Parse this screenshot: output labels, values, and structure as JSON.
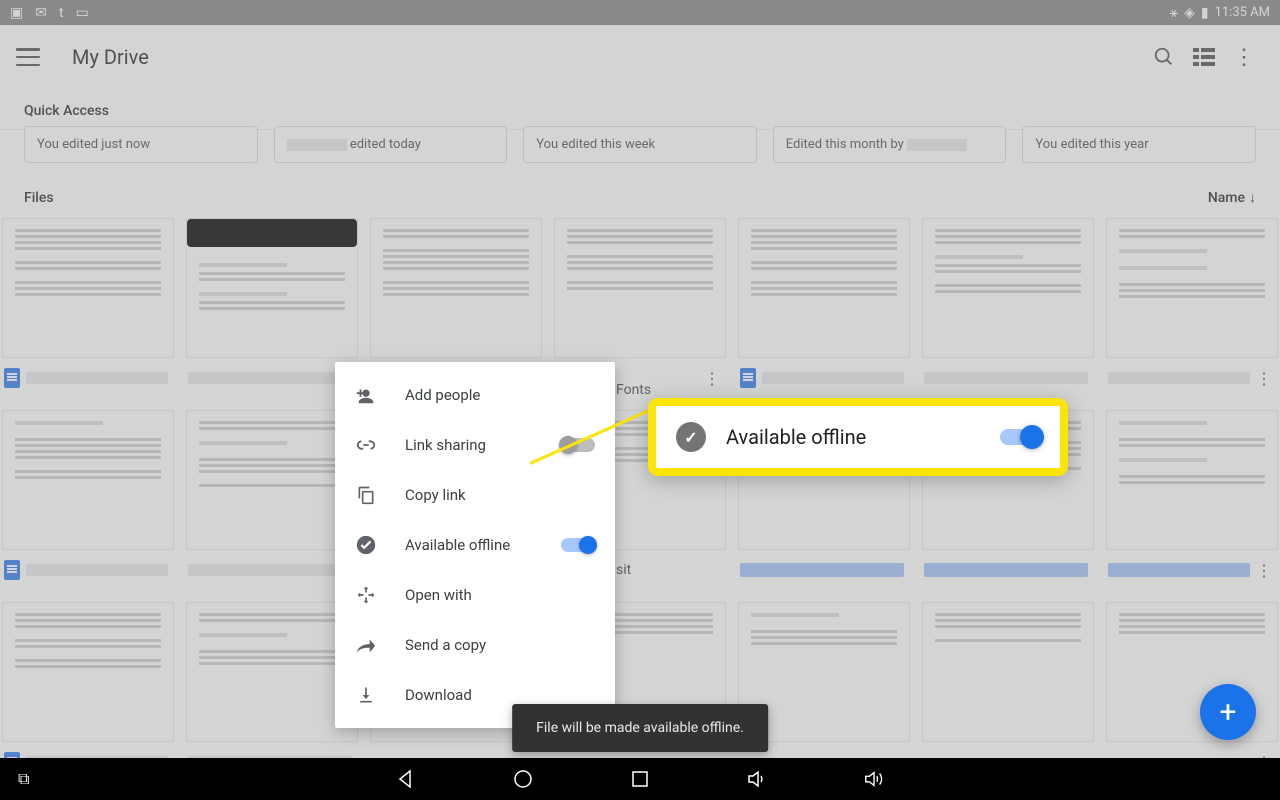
{
  "status_bar": {
    "time": "11:35 AM"
  },
  "app_bar": {
    "title": "My Drive"
  },
  "quick_access": {
    "header": "Quick Access",
    "cards": [
      {
        "subtitle": "You edited just now"
      },
      {
        "subtitle_prefix": "",
        "subtitle": "edited today"
      },
      {
        "subtitle": "You edited this week"
      },
      {
        "subtitle": "Edited this month by"
      },
      {
        "subtitle": "You edited this year"
      }
    ]
  },
  "files": {
    "header": "Files",
    "sort_label": "Name",
    "visible_labels": {
      "fonts": "Fonts",
      "sit": "sit"
    }
  },
  "menu": {
    "add_people": "Add people",
    "link_sharing": "Link sharing",
    "copy_link": "Copy link",
    "available_offline": "Available offline",
    "open_with": "Open with",
    "send_copy": "Send a copy",
    "download": "Download"
  },
  "callout": {
    "label": "Available offline"
  },
  "toast": {
    "message": "File will be made available offline."
  }
}
